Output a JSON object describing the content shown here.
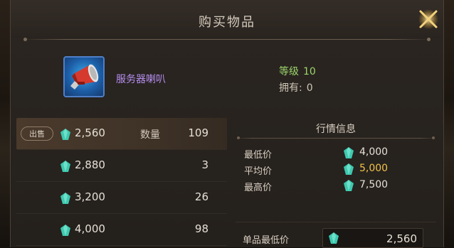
{
  "dialog": {
    "title": "购买物品"
  },
  "item": {
    "name": "服务器喇叭",
    "level_label": "等级",
    "level_value": "10",
    "owned_label": "拥有:",
    "owned_value": "0",
    "icon": "megaphone-icon"
  },
  "listings": {
    "sell_tag": "出售",
    "quantity_label": "数量",
    "rows": [
      {
        "price": "2,560",
        "quantity": "109"
      },
      {
        "price": "2,880",
        "quantity": "3"
      },
      {
        "price": "3,200",
        "quantity": "26"
      },
      {
        "price": "4,000",
        "quantity": "98"
      }
    ]
  },
  "market": {
    "title": "行情信息",
    "min_label": "最低价",
    "min_value": "4,000",
    "avg_label": "平均价",
    "avg_value": "5,000",
    "max_label": "最高价",
    "max_value": "7,500",
    "unit_min_label": "单品最低价",
    "unit_min_value": "2,560"
  },
  "colors": {
    "item_name": "#b68ef0",
    "level": "#9bd46a",
    "highlight_price": "#f2c24a",
    "gem": "#3ec9b0"
  }
}
